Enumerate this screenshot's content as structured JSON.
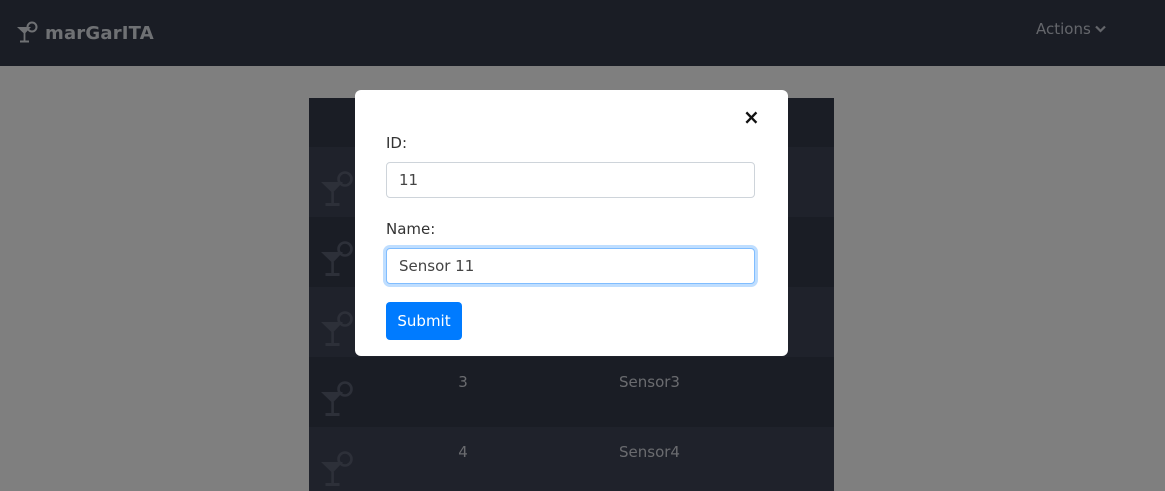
{
  "navbar": {
    "brand": "marGarITA",
    "actions_label": "Actions"
  },
  "table": {
    "rows": [
      {
        "id": "",
        "name": ""
      },
      {
        "id": "",
        "name": ""
      },
      {
        "id": "",
        "name": ""
      },
      {
        "id": "3",
        "name": "Sensor3"
      },
      {
        "id": "4",
        "name": "Sensor4"
      }
    ]
  },
  "modal": {
    "close_symbol": "×",
    "id_label": "ID:",
    "id_value": "11",
    "name_label": "Name:",
    "name_value": "Sensor 11",
    "submit_label": "Submit"
  },
  "icons": {
    "brand": "cocktail-icon",
    "row": "cocktail-icon",
    "actions": "chevron-down-icon",
    "close": "close-icon"
  }
}
